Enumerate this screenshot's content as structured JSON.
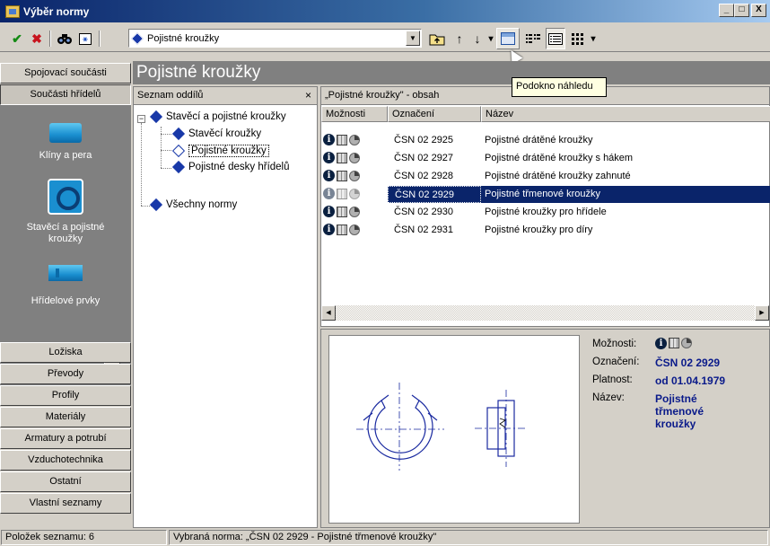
{
  "window": {
    "title": "Výběr normy",
    "min": "_",
    "max": "□",
    "close": "X"
  },
  "toolbar": {
    "check": "✔",
    "cancel": "✖",
    "find": "⚲",
    "filter": "⚹",
    "combo_value": "Pojistné kroužky",
    "up": "↑",
    "down": "↓",
    "tooltip": "Podokno náhledu"
  },
  "leftbar": {
    "top_buttons": [
      "Spojovací součásti",
      "Součásti hřídelů"
    ],
    "panel_items": [
      {
        "label": "Klíny a pera",
        "icon": "keys-icon"
      },
      {
        "label": "Stavěcí a pojistné kroužky",
        "icon": "retaining-ring-icon"
      },
      {
        "label": "Hřídelové prvky",
        "icon": "shaft-icon"
      }
    ],
    "bottom_buttons": [
      "Ložiska",
      "Převody",
      "Profily",
      "Materiály",
      "Armatury a potrubí",
      "Vzduchotechnika",
      "Ostatní",
      "Vlastní seznamy"
    ]
  },
  "main": {
    "title": "Pojistné kroužky"
  },
  "tree": {
    "header": "Seznam oddílů",
    "close": "×",
    "nodes": [
      {
        "label": "Stavěcí a pojistné kroužky"
      },
      {
        "label": "Stavěcí kroužky"
      },
      {
        "label": "Pojistné kroužky"
      },
      {
        "label": "Pojistné desky hřídelů"
      },
      {
        "label": "Všechny normy"
      }
    ]
  },
  "list": {
    "header": "„Pojistné kroužky\" - obsah",
    "columns": [
      "Možnosti",
      "Označení",
      "Název"
    ],
    "rows": [
      {
        "code": "ČSN 02 2925",
        "name": "Pojistné drátěné kroužky"
      },
      {
        "code": "ČSN 02 2927",
        "name": "Pojistné drátěné kroužky s hákem"
      },
      {
        "code": "ČSN 02 2928",
        "name": "Pojistné drátěné kroužky zahnuté"
      },
      {
        "code": "ČSN 02 2929",
        "name": "Pojistné třmenové kroužky"
      },
      {
        "code": "ČSN 02 2930",
        "name": "Pojistné kroužky pro hřídele"
      },
      {
        "code": "ČSN 02 2931",
        "name": "Pojistné kroužky pro díry"
      }
    ],
    "selected_index": 3
  },
  "preview": {
    "labels": {
      "options": "Možnosti:",
      "code": "Označení:",
      "validity": "Platnost:",
      "name": "Název:"
    },
    "code": "ČSN 02 2929",
    "validity": "od 01.04.1979",
    "name": "Pojistné třmenové kroužky"
  },
  "status": {
    "count": "Položek seznamu: 6",
    "selected": "Vybraná norma: „ČSN 02 2929 - Pojistné třmenové kroužky\""
  },
  "colors": {
    "selection": "#0a246a",
    "title_gradient_start": "#0a246a",
    "accent_blue": "#1838a8"
  }
}
